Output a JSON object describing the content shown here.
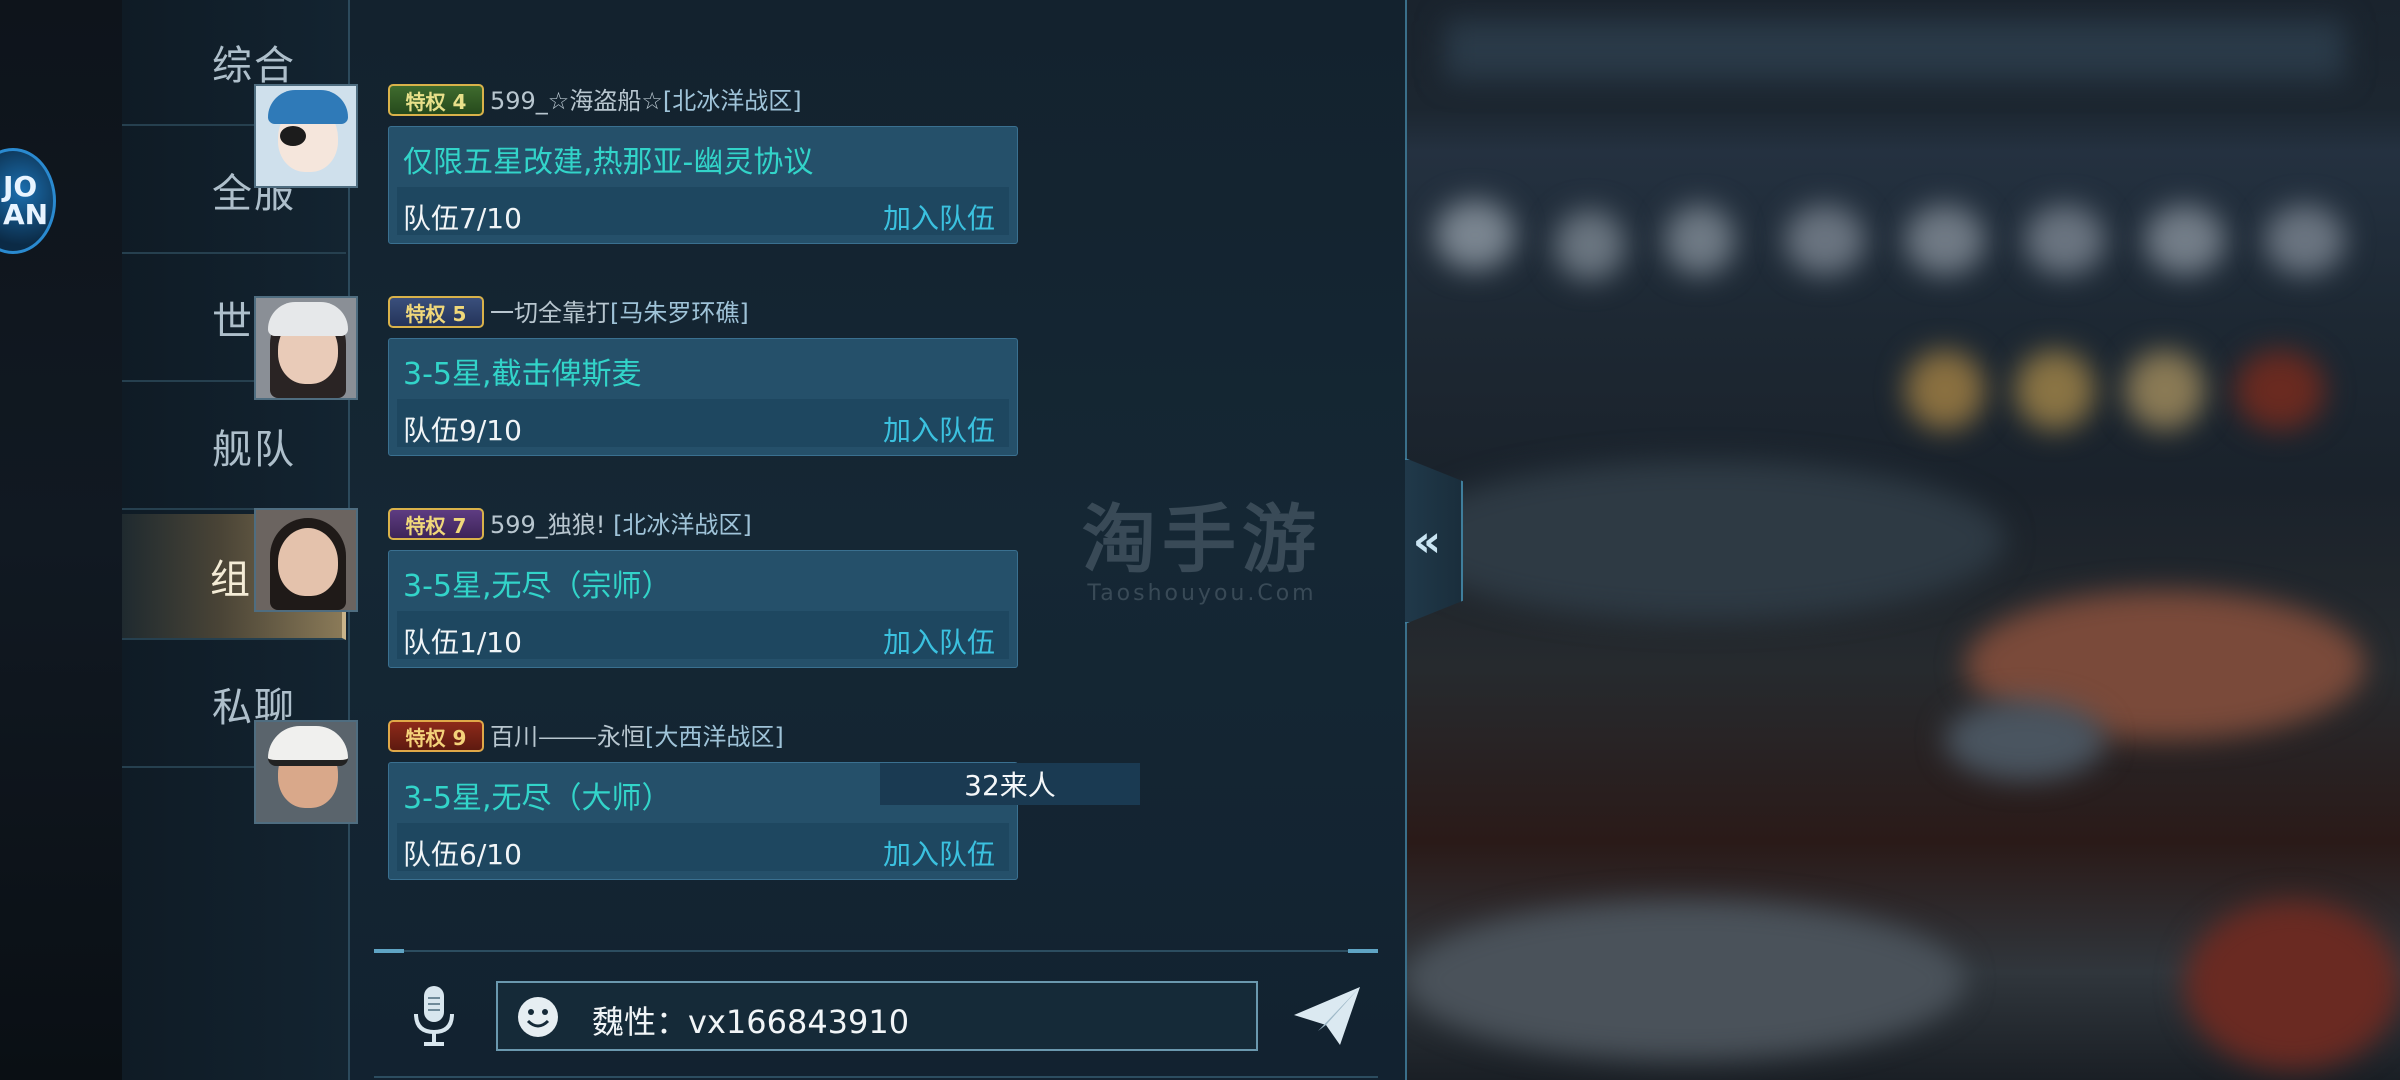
{
  "sidebar": {
    "tabs": [
      {
        "label": "综合",
        "active": false
      },
      {
        "label": "全服",
        "active": false
      },
      {
        "label": "世界",
        "active": false
      },
      {
        "label": "舰队",
        "active": false
      },
      {
        "label": "组队",
        "active": true
      },
      {
        "label": "私聊",
        "active": false
      }
    ]
  },
  "messages": [
    {
      "badge": "特权 4",
      "badge_color": "#3f6b2e",
      "sender": "599_☆海盗船☆",
      "zone": "[北冰洋战区]",
      "title": "仅限五星改建,热那亚-幽灵协议",
      "team": "队伍7/10",
      "join": "加入队伍"
    },
    {
      "badge": "特权 5",
      "badge_color": "#3a4f7c",
      "sender": "一切全靠打",
      "zone": "[马朱罗环礁]",
      "title": "3-5星,截击俾斯麦",
      "team": "队伍9/10",
      "join": "加入队伍"
    },
    {
      "badge": "特权 7",
      "badge_color": "#5e3c82",
      "sender": "599_独狼! ",
      "zone": "[北冰洋战区]",
      "title": "3-5星,无尽（宗师）",
      "team": "队伍1/10",
      "join": "加入队伍"
    },
    {
      "badge": "特权 9",
      "badge_color": "#8e2a1a",
      "sender": "百川⸻永恒",
      "zone": "[大西洋战区]",
      "title": "3-5星,无尽（大师）",
      "team": "队伍6/10",
      "join": "加入队伍"
    }
  ],
  "tooltip": "32来人",
  "watermark": {
    "main": "淘手游",
    "sub": "Taoshouyou.Com"
  },
  "input": {
    "value": "魏性：vx166843910"
  },
  "icons": {
    "collapse": "double-chevron-left-icon",
    "mic": "microphone-icon",
    "emoji": "emoji-icon",
    "send": "send-icon"
  },
  "colors": {
    "accent": "#32d4c9",
    "join": "#3bc1df",
    "bubble": "#25506a"
  }
}
